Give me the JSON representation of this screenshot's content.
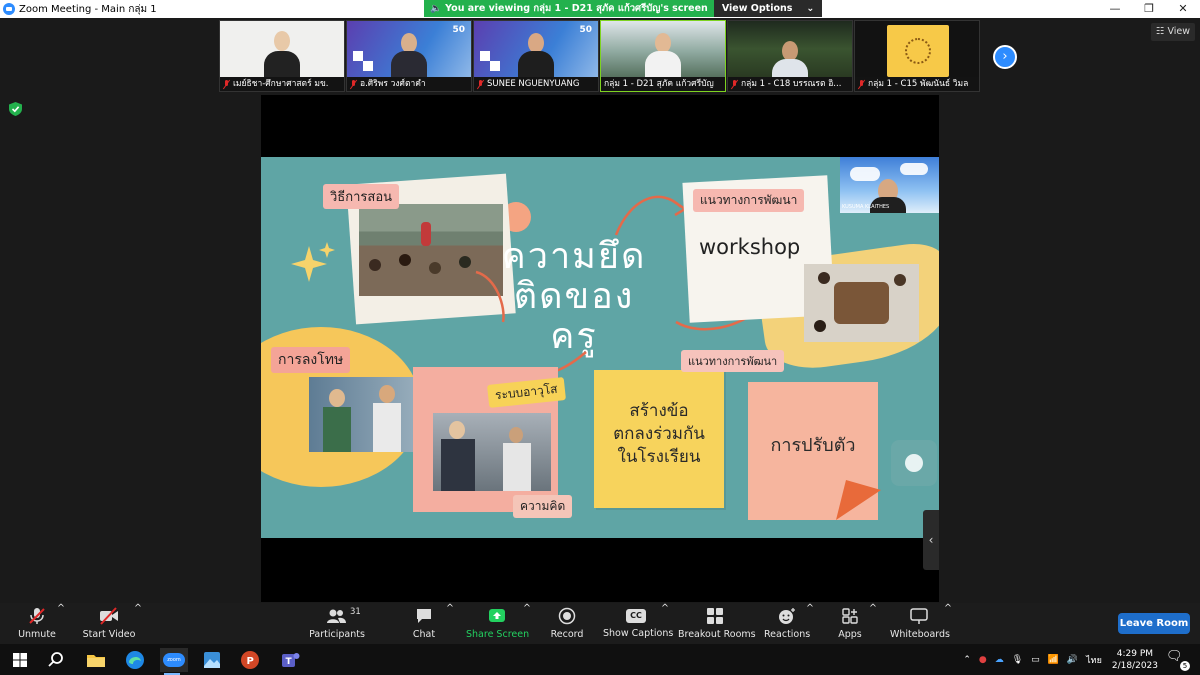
{
  "window": {
    "title": "Zoom Meeting - Main กลุ่ม 1",
    "controls": {
      "minimize": "—",
      "maximize": "❐",
      "close": "✕"
    }
  },
  "share_banner": {
    "message": "You are viewing กลุ่ม 1 - D21 สุภัค แก้วศรีบัญ's screen",
    "view_options": "View Options",
    "accent": "#23b14d"
  },
  "participants_strip": [
    {
      "name": "เมย์ธิชา-ศึกษาศาสตร์ มข.",
      "muted": true
    },
    {
      "name": "อ.ศิริพร วงศ์ตาคำ",
      "muted": true
    },
    {
      "name": "SUNEE NGUENYUANG",
      "muted": true
    },
    {
      "name": "กลุ่ม 1 - D21 สุภัค แก้วศรีบัญ",
      "muted": false,
      "active": true
    },
    {
      "name": "กลุ่ม 1 - C18 บรรณรต อิ...",
      "muted": true
    },
    {
      "name": "กลุ่ม 1 - C15 พัฒนันธ์ วิมล",
      "muted": true
    }
  ],
  "thumb_logo": "50",
  "view_button": "View",
  "slide": {
    "title_lines": [
      "ความยึด",
      "ติดของ",
      "ครู"
    ],
    "labels": {
      "teaching_method": "วิธีการสอน",
      "dev_guideline_1": "แนวทางการพัฒนา",
      "workshop": "workshop",
      "punishment": "การลงโทษ",
      "seniority": "ระบบอาวุโส",
      "dev_guideline_2": "แนวทางการพัฒนา",
      "agreement_lines": [
        "สร้างข้อ",
        "ตกลงร่วมกัน",
        "ในโรงเรียน"
      ],
      "adaptation": "การปรับตัว",
      "thinking": "ความคิด"
    },
    "presenter_name": "KUSUMA KLAITHES"
  },
  "toolbar": {
    "unmute": "Unmute",
    "start_video": "Start Video",
    "participants": "Participants",
    "participants_count": "31",
    "chat": "Chat",
    "share_screen": "Share Screen",
    "record": "Record",
    "show_captions": "Show Captions",
    "captions_icon_text": "CC",
    "breakout_rooms": "Breakout Rooms",
    "reactions": "Reactions",
    "apps": "Apps",
    "whiteboards": "Whiteboards",
    "leave_room": "Leave Room"
  },
  "taskbar": {
    "zoom_icon_text": "zoom",
    "language": "ไทย",
    "time": "4:29 PM",
    "date": "2/18/2023",
    "notification_count": "5"
  }
}
